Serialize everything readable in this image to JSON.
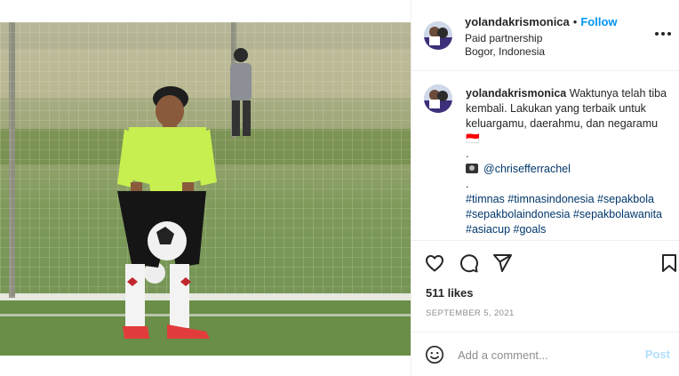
{
  "post": {
    "username": "yolandakrismonica",
    "follow_label": "Follow",
    "header_dot": "•",
    "paid_partnership": "Paid partnership",
    "location": "Bogor, Indonesia",
    "more_icon": "more-horizontal-icon"
  },
  "caption": {
    "username": "yolandakrismonica",
    "text": "Waktunya telah tiba kembali. Lakukan yang terbaik untuk keluargamu, daerahmu, dan negaramu 🇮🇩",
    "dot1": ".",
    "camera_icon": "camera-icon",
    "mention": "@chrisefferrachel",
    "dot2": ".",
    "hashtags": "#timnas #timnasindonesia #sepakbola #sepakbolaindonesia #sepakbolawanita #asiacup #goals"
  },
  "actions": {
    "like_icon": "heart-icon",
    "comment_icon": "comment-icon",
    "share_icon": "send-icon",
    "save_icon": "bookmark-icon"
  },
  "likes": "511 likes",
  "date": "SEPTEMBER 5, 2021",
  "comment": {
    "emoji_icon": "emoji-icon",
    "placeholder": "Add a comment...",
    "post_label": "Post"
  },
  "colors": {
    "accent": "#0095f6",
    "post_disabled": "#b2dffc",
    "link": "#00376b",
    "muted": "#8e8e8e"
  }
}
